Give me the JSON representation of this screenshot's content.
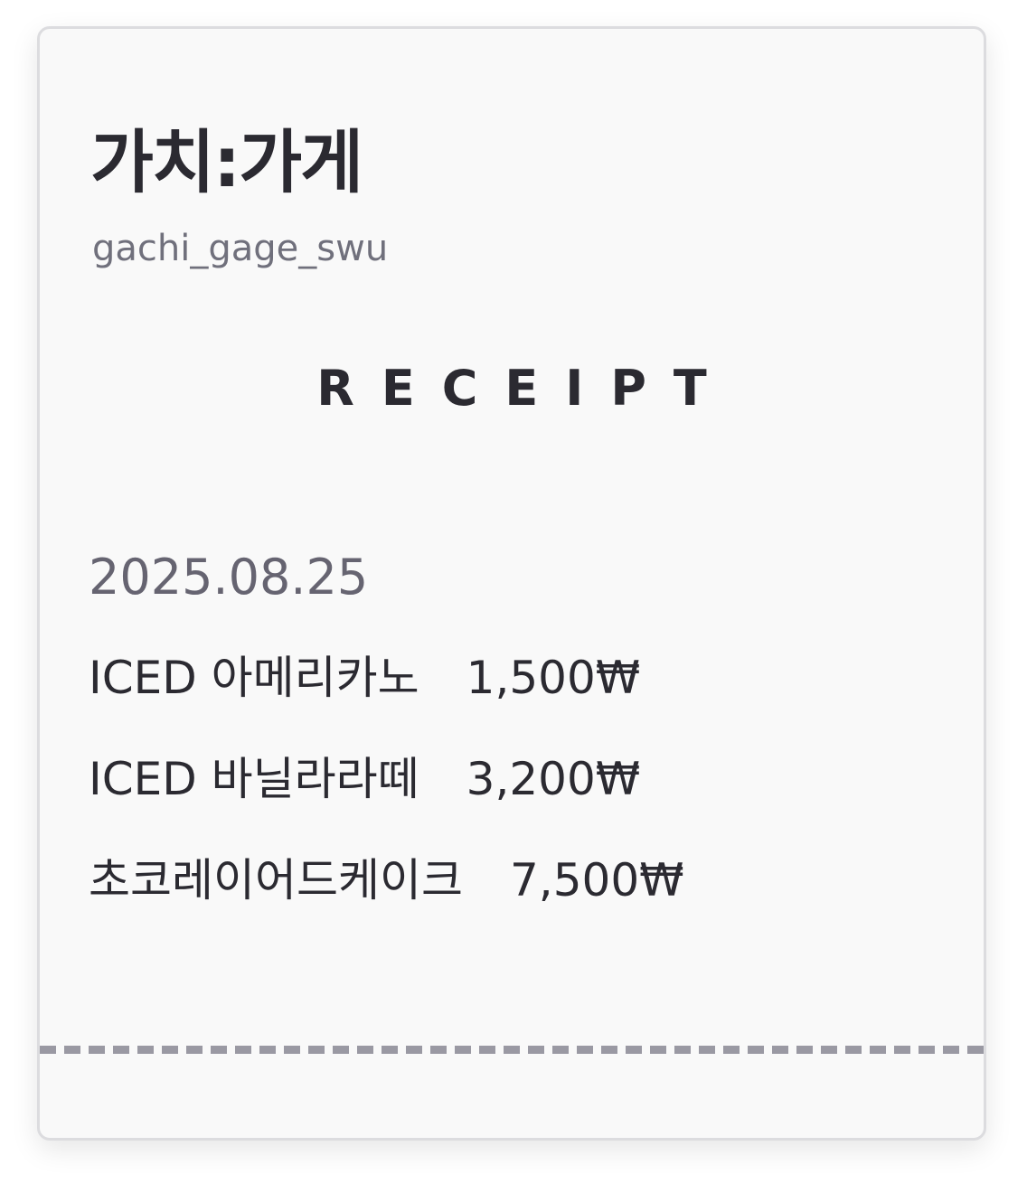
{
  "brand": {
    "name": "가치:가게",
    "handle": "gachi_gage_swu"
  },
  "receipt": {
    "title": "RECEIPT",
    "date": "2025.08.25",
    "items": [
      {
        "name": "ICED 아메리카노",
        "price": "1,500₩"
      },
      {
        "name": "ICED 바닐라라떼",
        "price": "3,200₩"
      },
      {
        "name": "초코레이어드케이크",
        "price": "7,500₩"
      }
    ]
  },
  "colors": {
    "card_background": "#f9f9f9",
    "card_border": "#dcdcdf",
    "text_primary": "#2b2a31",
    "text_secondary": "#70707c",
    "divider": "#9a99a3"
  }
}
